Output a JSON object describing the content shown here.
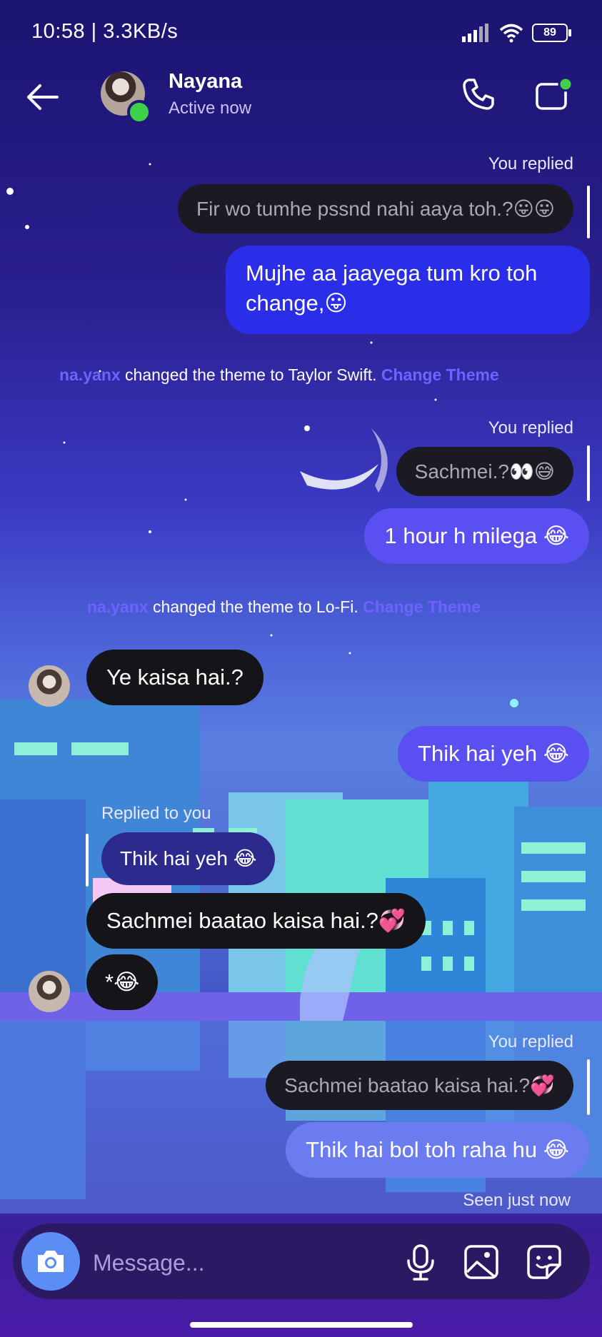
{
  "status_bar": {
    "time": "10:58 | 3.3KB/s",
    "battery": "89"
  },
  "header": {
    "name": "Nayana",
    "status": "Active now"
  },
  "messages": {
    "m1": {
      "meta": "You replied",
      "quote": "Fir wo tumhe pssnd nahi aaya toh.?😛😛",
      "text_line1": "Mujhe aa jaayega tum kro toh",
      "text_line2": "change,😛"
    },
    "sys1": {
      "user": "na.yanx",
      "text": " changed the theme to Taylor Swift. ",
      "link": "Change Theme"
    },
    "m2": {
      "meta": "You replied",
      "quote": "Sachmei.?👀😅",
      "text": "1 hour h milega 😂"
    },
    "sys2": {
      "user": "na.yanx",
      "text": " changed the theme to Lo-Fi. ",
      "link": "Change Theme"
    },
    "m3": {
      "text": "Ye kaisa hai.?"
    },
    "m4": {
      "text": "Thik hai yeh 😂"
    },
    "m5": {
      "meta": "Replied to you",
      "quote": "Thik hai yeh 😂",
      "text": "Sachmei baatao kaisa hai.?💞"
    },
    "m6": {
      "text": "*😂"
    },
    "m7": {
      "meta": "You replied",
      "quote": "Sachmei baatao kaisa hai.?💞",
      "text": "Thik hai bol toh raha hu 😂"
    },
    "seen": "Seen just now"
  },
  "composer": {
    "placeholder": "Message..."
  },
  "icons": {
    "back": "arrow-left-icon",
    "call": "phone-icon",
    "video": "video-camera-icon",
    "camera": "camera-icon",
    "mic": "microphone-icon",
    "gallery": "image-icon",
    "sticker": "sticker-icon"
  },
  "colors": {
    "outgoing_blue": "#2b2ee8",
    "outgoing_violet": "#5a4ff0",
    "incoming_dark": "#151419",
    "link": "#6d63ff",
    "online": "#3fd04a"
  }
}
